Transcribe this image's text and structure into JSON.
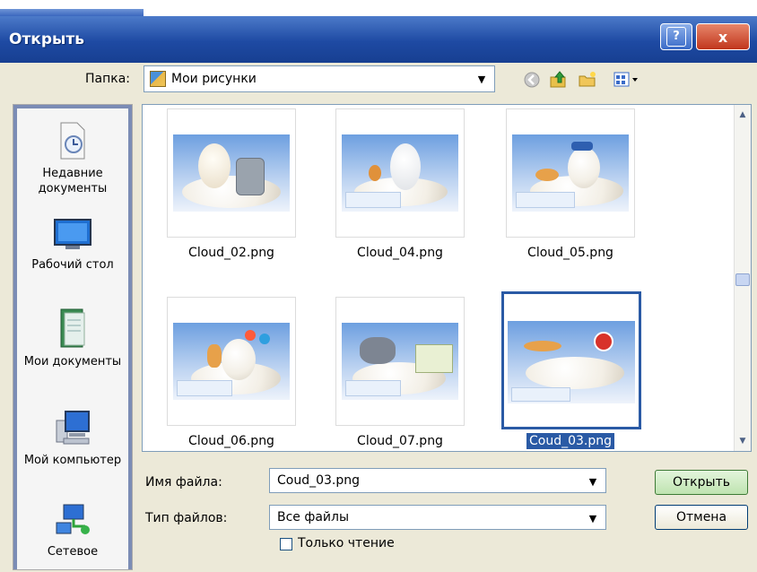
{
  "dialog": {
    "title": "Открыть",
    "help_button": "?",
    "close_button": "x"
  },
  "toolbar": {
    "folder_label": "Папка:",
    "folder_value": "Мои рисунки",
    "icons": [
      "back-icon",
      "up-folder-icon",
      "new-folder-icon",
      "view-menu-icon"
    ]
  },
  "places": [
    {
      "label": "Недавние документы",
      "icon": "recent-documents-icon"
    },
    {
      "label": "Рабочий стол",
      "icon": "desktop-icon"
    },
    {
      "label": "Мои документы",
      "icon": "my-documents-icon"
    },
    {
      "label": "Мой компьютер",
      "icon": "my-computer-icon"
    },
    {
      "label": "Сетевое",
      "icon": "network-icon"
    }
  ],
  "files": [
    {
      "name": "Cloud_02.png",
      "selected": false
    },
    {
      "name": "Cloud_04.png",
      "selected": false
    },
    {
      "name": "Cloud_05.png",
      "selected": false
    },
    {
      "name": "Cloud_06.png",
      "selected": false
    },
    {
      "name": "Cloud_07.png",
      "selected": false
    },
    {
      "name": "Coud_03.png",
      "selected": true
    }
  ],
  "form": {
    "filename_label": "Имя файла:",
    "filename_value": "Coud_03.png",
    "filetype_label": "Тип файлов:",
    "filetype_value": "Все файлы",
    "readonly_label": "Только чтение",
    "readonly_checked": false,
    "open_button": "Открыть",
    "cancel_button": "Отмена"
  },
  "colors": {
    "titlebar": "#1e4aa3",
    "selection": "#2a5aa5"
  }
}
